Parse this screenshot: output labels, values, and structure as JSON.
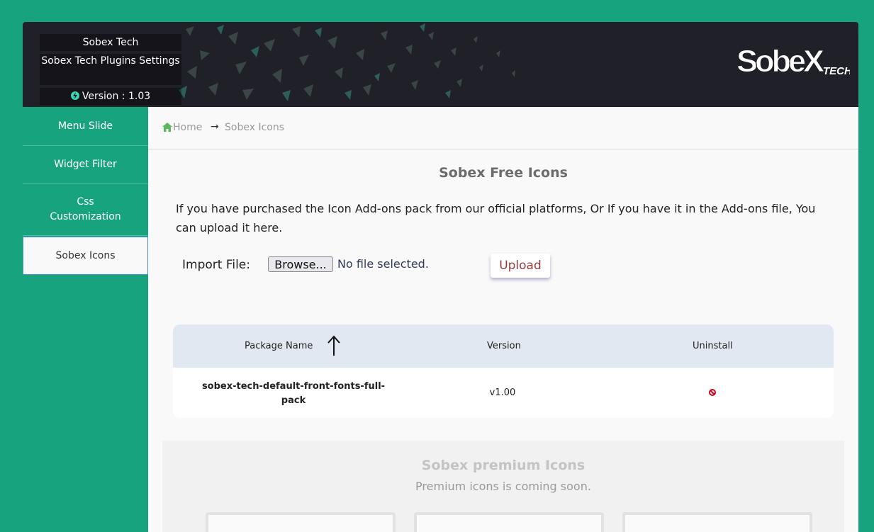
{
  "header": {
    "brand_name": "Sobex Tech",
    "title": "Sobex Tech Plugins Settings",
    "version": "Version : 1.03",
    "logo_text": "SobeX",
    "logo_sub": "TECH"
  },
  "sidebar": {
    "items": [
      {
        "label": "Menu Slide"
      },
      {
        "label": "Widget Filter"
      },
      {
        "label": "Css Customization"
      },
      {
        "label": "Sobex Icons",
        "active": true
      }
    ]
  },
  "breadcrumb": {
    "home": "Home",
    "separator": "→",
    "current": "Sobex Icons"
  },
  "free_icons": {
    "title": "Sobex Free Icons",
    "intro": "If you have purchased the Icon Add-ons pack from our official platforms, Or If you have it in the Add-ons file, You can upload it here.",
    "import_label": "Import File:",
    "browse_label": "Browse...",
    "file_status": "No file selected.",
    "upload_label": "Upload"
  },
  "table": {
    "columns": [
      "Package Name",
      "Version",
      "Uninstall"
    ],
    "rows": [
      {
        "name": "sobex-tech-default-front-fonts-full-pack",
        "version": "v1.00"
      }
    ]
  },
  "premium": {
    "title": "Sobex premium Icons",
    "subtitle": "Premium icons is coming soon."
  },
  "colors": {
    "background": "#17a37d",
    "header": "#1f2028",
    "content": "#f9f9f9",
    "table_header": "#e2e8f1",
    "upload_text": "#9b3a3a",
    "uninstall": "#d0021b"
  },
  "icons": [
    "home-icon",
    "lightning-icon",
    "sort-arrow-up-icon",
    "uninstall-icon"
  ]
}
